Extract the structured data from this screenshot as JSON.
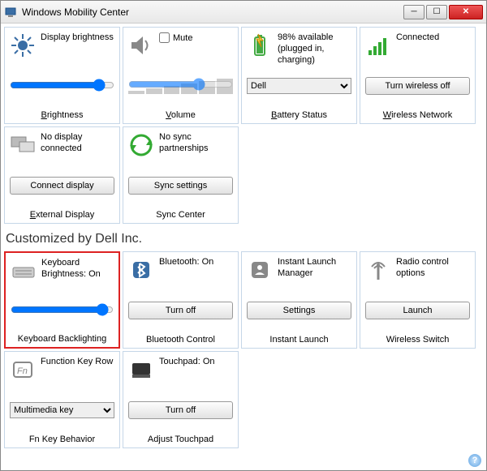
{
  "window": {
    "title": "Windows Mobility Center"
  },
  "tiles": {
    "brightness": {
      "label": "Display brightness",
      "footer_pre": "B",
      "footer_post": "rightness",
      "value": 90
    },
    "volume": {
      "label_pre": "M",
      "label_post": "ute",
      "footer_pre": "V",
      "footer_post": "olume",
      "value": 70,
      "muted": false
    },
    "battery": {
      "status": "98% available (plugged in, charging)",
      "plan": "Dell",
      "footer_pre": "B",
      "footer_post": "attery Status"
    },
    "wireless": {
      "label": "Connected",
      "button_pre": "T",
      "button_post": "urn wireless off",
      "footer_pre": "W",
      "footer_post": "ireless Network"
    },
    "external": {
      "label": "No display connected",
      "button_pre": "C",
      "button_post": "onnect display",
      "footer_pre": "E",
      "footer_post": "xternal Display"
    },
    "sync": {
      "label": "No sync partnerships",
      "button_pre": "S",
      "button_post": "ync settings",
      "footer": "Sync Center"
    },
    "kbd": {
      "label": "Keyboard Brightness: On",
      "footer": "Keyboard Backlighting",
      "value": 95
    },
    "bt": {
      "label": "Bluetooth: On",
      "button": "Turn off",
      "footer": "Bluetooth Control"
    },
    "launch": {
      "label": "Instant Launch Manager",
      "button": "Settings",
      "footer": "Instant Launch"
    },
    "radio": {
      "label": "Radio control options",
      "button": "Launch",
      "footer": "Wireless Switch"
    },
    "fn": {
      "label": "Function Key Row",
      "selected": "Multimedia key",
      "footer": "Fn Key Behavior"
    },
    "touchpad": {
      "label": "Touchpad: On",
      "button": "Turn off",
      "footer": "Adjust Touchpad"
    }
  },
  "section": {
    "custom": "Customized by Dell Inc."
  }
}
